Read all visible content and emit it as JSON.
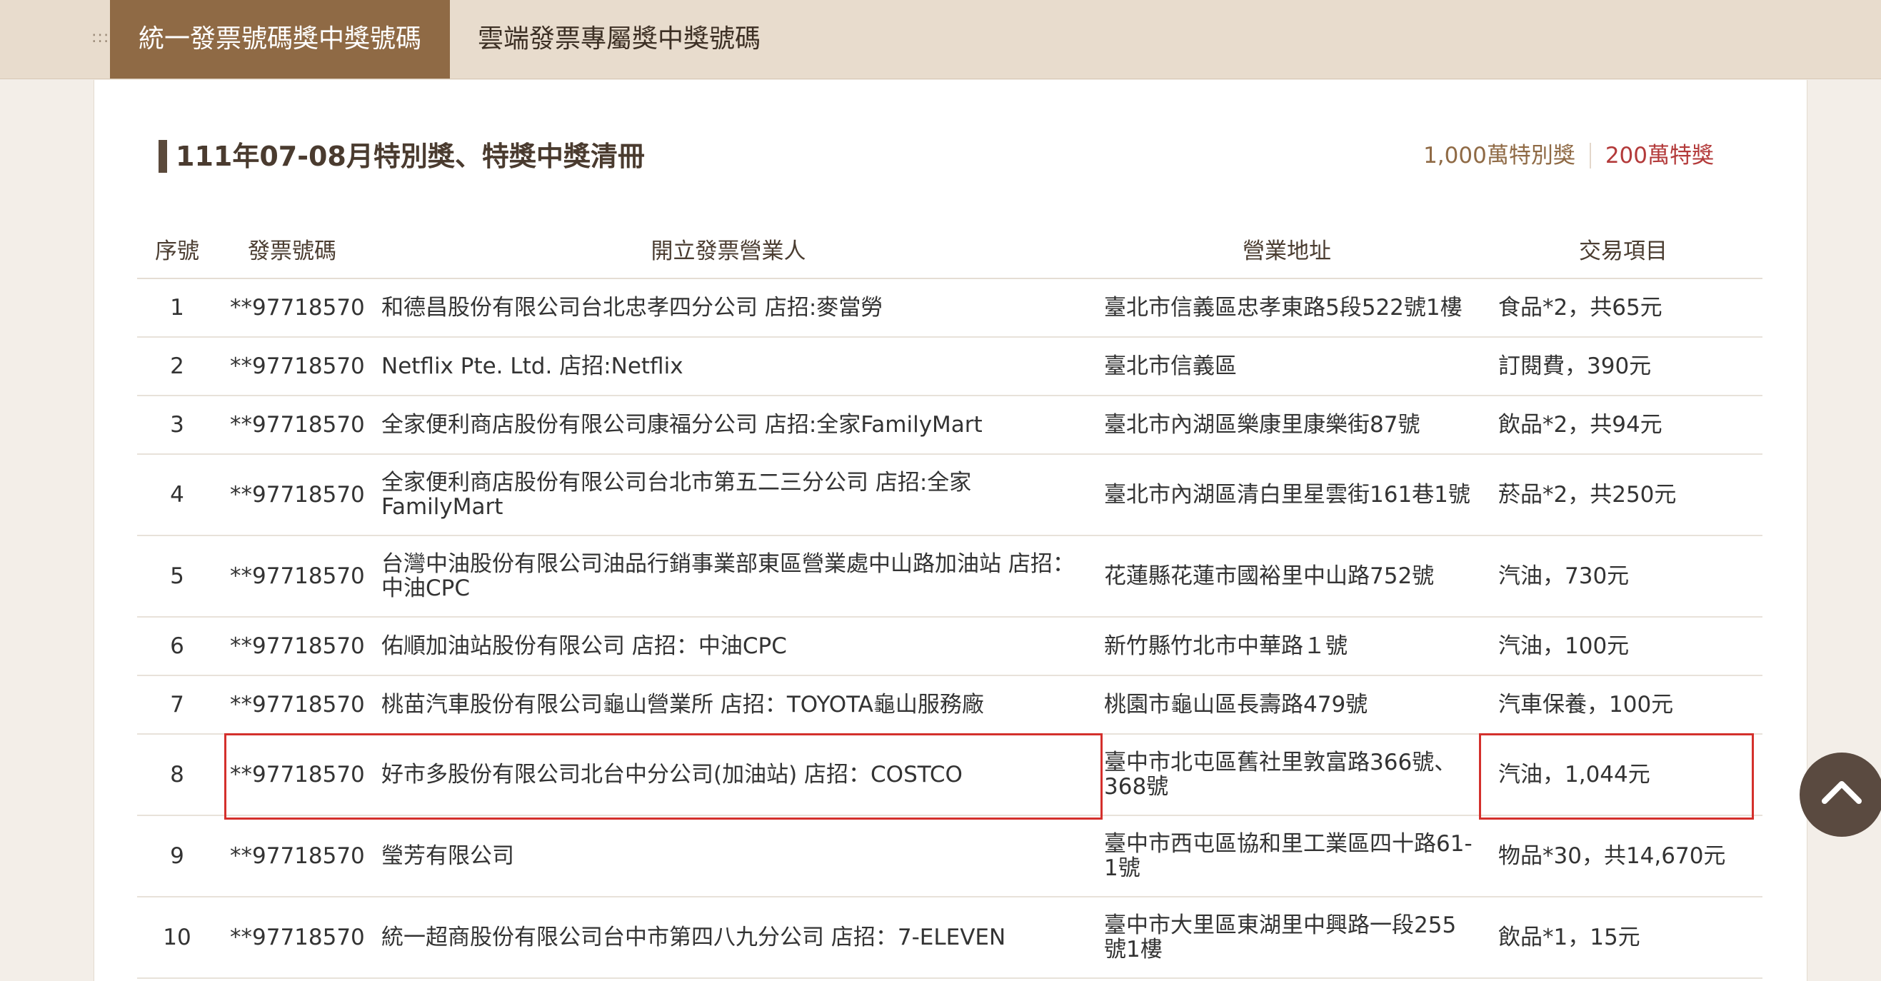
{
  "tabs": {
    "handle": ":::",
    "active_label": "統一發票號碼獎中獎號碼",
    "inactive_label": "雲端發票專屬獎中獎號碼"
  },
  "section": {
    "title": "111年07-08月特別獎、特獎中獎清冊",
    "prize_links": [
      "1,000萬特別獎",
      "200萬特獎"
    ]
  },
  "table": {
    "headers": [
      "序號",
      "發票號碼",
      "開立發票營業人",
      "營業地址",
      "交易項目"
    ],
    "rows": [
      {
        "seq": "1",
        "invoice": "**97718570",
        "shop": "和德昌股份有限公司台北忠孝四分公司 店招:麥當勞",
        "address": "臺北市信義區忠孝東路5段522號1樓",
        "item": "食品*2，共65元"
      },
      {
        "seq": "2",
        "invoice": "**97718570",
        "shop": "Netflix Pte. Ltd. 店招:Netflix",
        "address": "臺北市信義區",
        "item": "訂閱費，390元"
      },
      {
        "seq": "3",
        "invoice": "**97718570",
        "shop": "全家便利商店股份有限公司康福分公司 店招:全家FamilyMart",
        "address": "臺北市內湖區樂康里康樂街87號",
        "item": "飲品*2，共94元"
      },
      {
        "seq": "4",
        "invoice": "**97718570",
        "shop": "全家便利商店股份有限公司台北市第五二三分公司 店招:全家FamilyMart",
        "address": "臺北市內湖區清白里星雲街161巷1號",
        "item": "菸品*2，共250元"
      },
      {
        "seq": "5",
        "invoice": "**97718570",
        "shop": "台灣中油股份有限公司油品行銷事業部東區營業處中山路加油站 店招：中油CPC",
        "address": "花蓮縣花蓮市國裕里中山路752號",
        "item": "汽油，730元"
      },
      {
        "seq": "6",
        "invoice": "**97718570",
        "shop": "佑順加油站股份有限公司 店招：中油CPC",
        "address": "新竹縣竹北市中華路１號",
        "item": "汽油，100元"
      },
      {
        "seq": "7",
        "invoice": "**97718570",
        "shop": "桃苗汽車股份有限公司龜山營業所 店招：TOYOTA龜山服務廠",
        "address": "桃園市龜山區長壽路479號",
        "item": "汽車保養，100元"
      },
      {
        "seq": "8",
        "invoice": "**97718570",
        "shop": "好市多股份有限公司北台中分公司(加油站) 店招：COSTCO",
        "address": "臺中市北屯區舊社里敦富路366號、368號",
        "item": "汽油，1,044元"
      },
      {
        "seq": "9",
        "invoice": "**97718570",
        "shop": "瑩芳有限公司",
        "address": "臺中市西屯區協和里工業區四十路61-1號",
        "item": "物品*30，共14,670元"
      },
      {
        "seq": "10",
        "invoice": "**97718570",
        "shop": "統一超商股份有限公司台中市第四八九分公司 店招：7-ELEVEN",
        "address": "臺中市大里區東湖里中興路一段255號1樓",
        "item": "飲品*1，15元"
      }
    ]
  },
  "colors": {
    "tab_active_bg": "#8f6a45",
    "tab_bar_bg": "#e8dccd",
    "highlight_border": "#d4302c",
    "special_prize_link": "#8f6a45",
    "grand_prize_link": "#b33a3a"
  },
  "icons": {
    "scroll_top": "chevron-up-icon"
  }
}
